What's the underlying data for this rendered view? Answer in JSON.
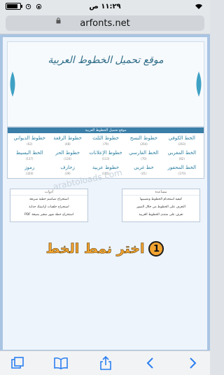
{
  "status": {
    "time": "١١:٢٩ ص",
    "battery_level": 0.82
  },
  "address": {
    "url": "arfonts.net"
  },
  "site": {
    "title": "موقع تحميل الخطوط العربية",
    "panel_title": "موقع تحميل الخطوط العربية",
    "fonts": [
      {
        "name": "الخط الكوفي",
        "count": "(263)"
      },
      {
        "name": "خطوط النسخ",
        "count": "(264)"
      },
      {
        "name": "خطوط الثلث",
        "count": "(79)"
      },
      {
        "name": "خطوط الرقعة",
        "count": "(48)"
      },
      {
        "name": "خطوط الديواني",
        "count": "(62)"
      },
      {
        "name": "الخط المغربي",
        "count": "(82)"
      },
      {
        "name": "الخط الفارسي",
        "count": "(70)"
      },
      {
        "name": "خطوط الإعلانات",
        "count": "(113)"
      },
      {
        "name": "خطوط الحر",
        "count": "(124)"
      },
      {
        "name": "الخط البسيط",
        "count": "(137)"
      },
      {
        "name": "الخط المحفور",
        "count": "(170)"
      },
      {
        "name": "خط غربي",
        "count": "(41)"
      },
      {
        "name": "خطوط عربية",
        "count": "(165)"
      },
      {
        "name": "زخارف",
        "count": "(39)"
      },
      {
        "name": "رموز",
        "count": "(320)"
      }
    ],
    "help_box": {
      "title": "مساعدة",
      "lines": [
        "كيفية استخدام الخطوط وتنصيبها",
        "التعرف على الخطوط من خلال الصور",
        "تعرف على منتدى الخطوط العربية"
      ]
    },
    "tools_box": {
      "title": "أدوات",
      "lines": [
        "استخراج تصاميم خطية سريعة",
        "استخراج خلفيات ازاستك جذابة",
        "استخراج خطة شهر صغير بصيغة PDF"
      ]
    },
    "watermark": "arabtoloads.com"
  },
  "step": {
    "number": "1",
    "text": "اختر نمط الخط"
  },
  "toolbar": {
    "icons": [
      "tabs-icon",
      "bookmarks-icon",
      "share-icon",
      "forward-icon",
      "back-icon"
    ]
  }
}
